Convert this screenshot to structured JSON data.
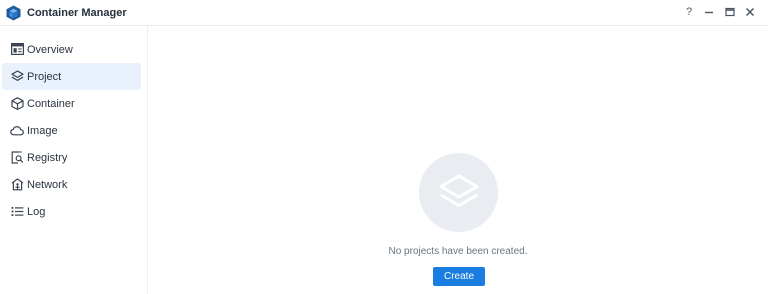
{
  "window": {
    "title": "Container Manager",
    "controls": [
      {
        "name": "help",
        "glyph": "?"
      },
      {
        "name": "minimize",
        "glyph": "—"
      },
      {
        "name": "maximize",
        "glyph": "▭"
      },
      {
        "name": "close",
        "glyph": "✕"
      }
    ]
  },
  "sidebar": {
    "items": [
      {
        "label": "Overview",
        "icon": "overview-icon",
        "active": false
      },
      {
        "label": "Project",
        "icon": "layers-icon",
        "active": true
      },
      {
        "label": "Container",
        "icon": "cube-icon",
        "active": false
      },
      {
        "label": "Image",
        "icon": "cloud-icon",
        "active": false
      },
      {
        "label": "Registry",
        "icon": "registry-search-icon",
        "active": false
      },
      {
        "label": "Network",
        "icon": "network-house-icon",
        "active": false
      },
      {
        "label": "Log",
        "icon": "list-icon",
        "active": false
      }
    ]
  },
  "main": {
    "empty_message": "No projects have been created.",
    "create_label": "Create"
  },
  "colors": {
    "accent": "#1a7de0",
    "active_item_bg": "#e8f1fc",
    "app_icon": "#1d5a9e",
    "illustration_bg": "#e9edf2"
  }
}
